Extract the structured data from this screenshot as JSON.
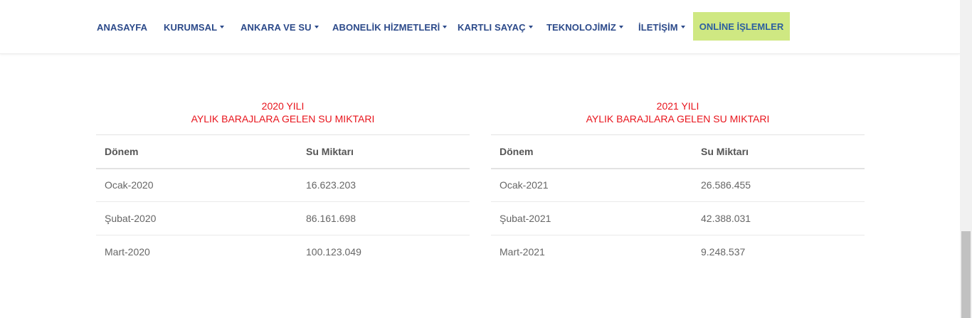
{
  "nav": {
    "items": [
      {
        "label": "ANASAYFA",
        "dropdown": false
      },
      {
        "label": "KURUMSAL",
        "dropdown": true
      },
      {
        "label": "ANKARA VE SU",
        "dropdown": true
      },
      {
        "label": "ABONELİK HİZMETLERİ",
        "dropdown": true
      },
      {
        "label": "KARTLI SAYAÇ",
        "dropdown": true
      },
      {
        "label": "TEKNOLOJİMİZ",
        "dropdown": true
      },
      {
        "label": "İLETİŞİM",
        "dropdown": true
      }
    ],
    "online_button": "ONLİNE İŞLEMLER"
  },
  "tables": [
    {
      "title_line1": "2020 YILI",
      "title_line2": "AYLIK BARAJLARA GELEN SU MIKTARI",
      "headers": [
        "Dönem",
        "Su Miktarı"
      ],
      "rows": [
        [
          "Ocak-2020",
          "16.623.203"
        ],
        [
          "Şubat-2020",
          "86.161.698"
        ],
        [
          "Mart-2020",
          "100.123.049"
        ]
      ]
    },
    {
      "title_line1": "2021 YILI",
      "title_line2": "AYLIK BARAJLARA GELEN SU MIKTARI",
      "headers": [
        "Dönem",
        "Su Miktarı"
      ],
      "rows": [
        [
          "Ocak-2021",
          "26.586.455"
        ],
        [
          "Şubat-2021",
          "42.388.031"
        ],
        [
          "Mart-2021",
          "9.248.537"
        ]
      ]
    }
  ],
  "colors": {
    "nav_text": "#2c4a8a",
    "online_button_bg": "#cfe882",
    "title_red": "#e8141c"
  }
}
